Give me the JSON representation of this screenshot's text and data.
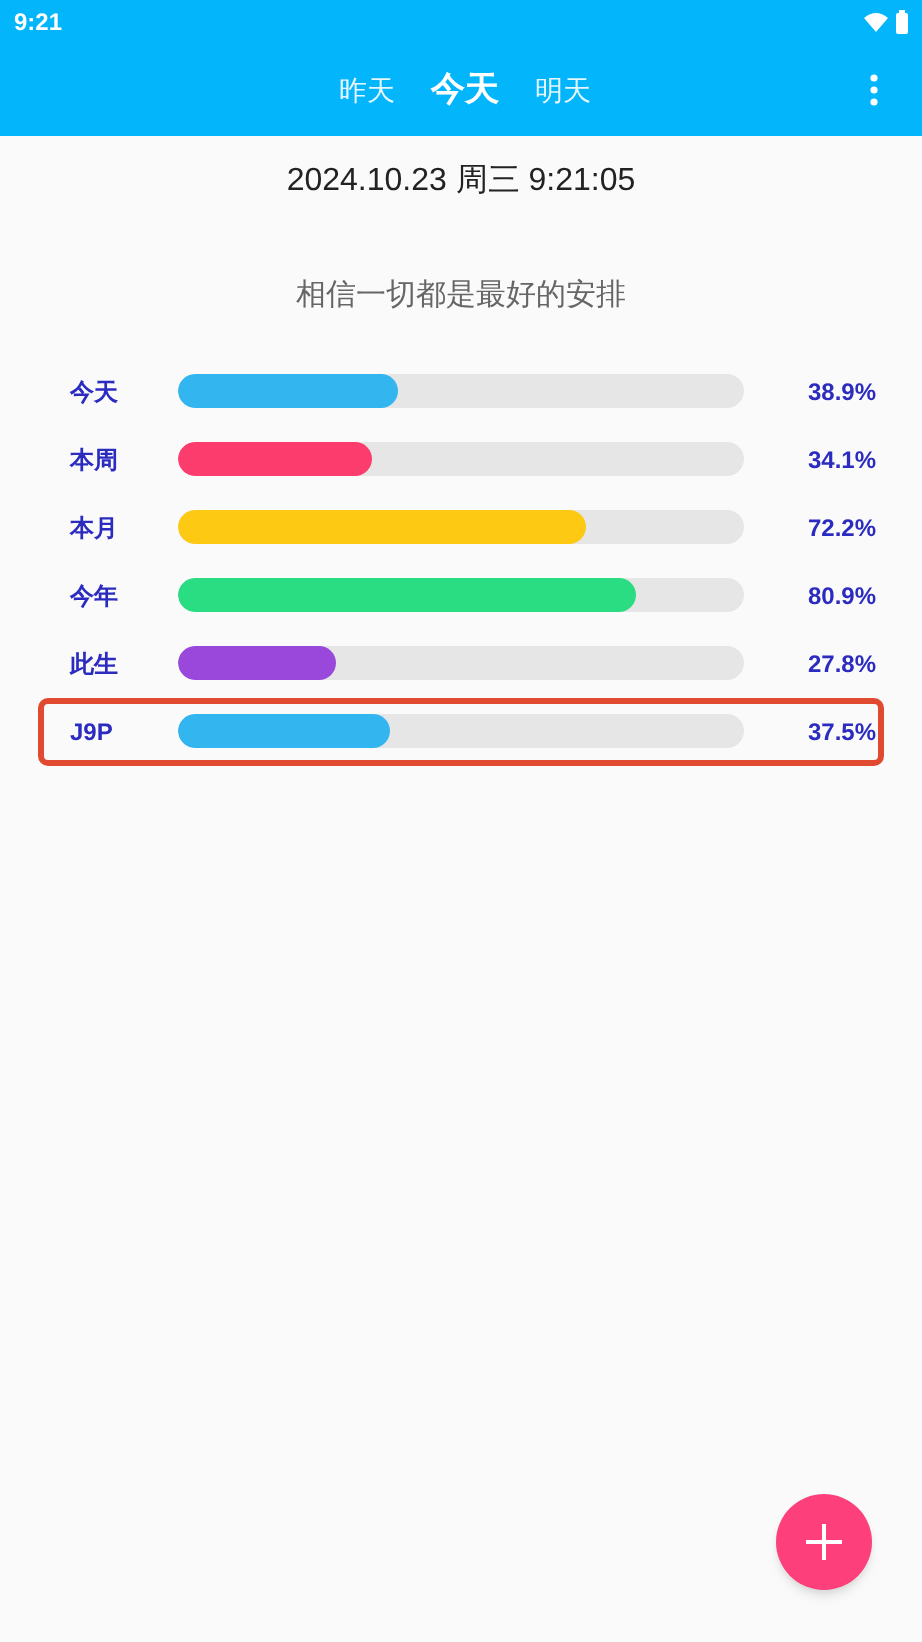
{
  "status_bar": {
    "time": "9:21"
  },
  "tabs": [
    {
      "label": "昨天",
      "selected": false
    },
    {
      "label": "今天",
      "selected": true
    },
    {
      "label": "明天",
      "selected": false
    }
  ],
  "datetime": "2024.10.23 周三 9:21:05",
  "motto": "相信一切都是最好的安排",
  "progress": [
    {
      "label": "今天",
      "level": 0.389,
      "reading": "38.9%",
      "color": "#33b5f0",
      "highlighted": false
    },
    {
      "label": "本周",
      "level": 0.341,
      "reading": "34.1%",
      "color": "#fc3c6c",
      "highlighted": false
    },
    {
      "label": "本月",
      "level": 0.722,
      "reading": "72.2%",
      "color": "#fec913",
      "highlighted": false
    },
    {
      "label": "今年",
      "level": 0.809,
      "reading": "80.9%",
      "color": "#2adc82",
      "highlighted": false
    },
    {
      "label": "此生",
      "level": 0.278,
      "reading": "27.8%",
      "color": "#9a48dc",
      "highlighted": false
    },
    {
      "label": "J9P",
      "level": 0.375,
      "reading": "37.5%",
      "color": "#33b5f0",
      "highlighted": true
    }
  ]
}
